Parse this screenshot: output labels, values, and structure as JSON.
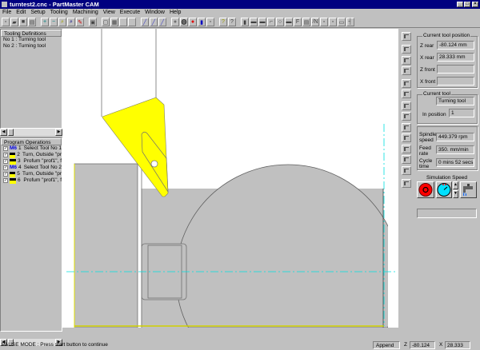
{
  "window": {
    "title": "turntest2.cnc - PartMaster CAM",
    "controls": [
      "_",
      "□",
      "×"
    ]
  },
  "menu": [
    "File",
    "Edit",
    "Setup",
    "Tooling",
    "Machining",
    "View",
    "Execute",
    "Window",
    "Help"
  ],
  "toolbar": {
    "buttons": [
      {
        "icon": "new-file-icon",
        "glyph": "▫"
      },
      {
        "icon": "open-folder-icon",
        "glyph": "▰"
      },
      {
        "icon": "save-icon",
        "glyph": "■"
      },
      {
        "icon": "print-icon",
        "glyph": "▤"
      },
      {
        "sep": true
      },
      {
        "icon": "zoom-in-icon",
        "glyph": "+"
      },
      {
        "icon": "zoom-out-icon",
        "glyph": "−"
      },
      {
        "icon": "zoom-window-icon",
        "glyph": "⌕"
      },
      {
        "icon": "zoom-all-icon",
        "glyph": "⌕"
      },
      {
        "icon": "pencil-icon",
        "glyph": "✎"
      },
      {
        "sep": true
      },
      {
        "icon": "display-icon",
        "glyph": "▣"
      },
      {
        "sep": true
      },
      {
        "icon": "view-icon",
        "glyph": "▢"
      },
      {
        "icon": "layout-icon",
        "glyph": "▦"
      },
      {
        "icon": "blank-icon",
        "glyph": ""
      },
      {
        "icon": "blank-icon",
        "glyph": ""
      },
      {
        "sep": true
      },
      {
        "icon": "tool-path-icon",
        "glyph": "╱"
      },
      {
        "icon": "tool-path-active-icon",
        "glyph": "╱"
      },
      {
        "icon": "line-icon",
        "glyph": "╱"
      },
      {
        "sep": true
      },
      {
        "icon": "stop-gray-icon",
        "glyph": "●"
      },
      {
        "icon": "pause-icon",
        "glyph": "⓿"
      },
      {
        "icon": "stop-red-icon",
        "glyph": "●"
      },
      {
        "icon": "step-icon",
        "glyph": "▮"
      },
      {
        "icon": "single-step-icon",
        "glyph": "▫"
      },
      {
        "sep": true
      },
      {
        "icon": "help-icon",
        "glyph": "?"
      },
      {
        "icon": "context-help-icon",
        "glyph": "?"
      },
      {
        "sep": true
      },
      {
        "icon": "op-1-icon",
        "glyph": "▮"
      },
      {
        "icon": "op-2-icon",
        "glyph": "▬"
      },
      {
        "icon": "op-3-icon",
        "glyph": "▬"
      },
      {
        "icon": "op-4-icon",
        "glyph": "⌐"
      },
      {
        "icon": "op-5-icon",
        "glyph": "○"
      },
      {
        "icon": "op-6-icon",
        "glyph": "▬"
      },
      {
        "icon": "op-7-icon",
        "glyph": "F"
      },
      {
        "icon": "op-8-icon",
        "glyph": "▤"
      },
      {
        "icon": "op-9-icon",
        "glyph": "/N"
      },
      {
        "icon": "op-10-icon",
        "glyph": "▫"
      },
      {
        "icon": "op-11-icon",
        "glyph": "▫"
      },
      {
        "icon": "op-12-icon",
        "glyph": "▭"
      },
      {
        "icon": "op-13-icon",
        "glyph": "┤"
      }
    ]
  },
  "tooling": {
    "header": "Tooling Definitions",
    "items": [
      "No 1 : Turning tool",
      "No 2 : Turning tool"
    ]
  },
  "operations": {
    "header": "Program Operations",
    "items": [
      {
        "code": "M6",
        "num": "1",
        "text": "Select Tool No 1",
        "checked": true
      },
      {
        "code": "",
        "num": "2",
        "text": "Turn, Outside \"pr",
        "checked": true
      },
      {
        "code": "",
        "num": "3",
        "text": "Profum \"prof1\", f",
        "checked": true
      },
      {
        "code": "M6",
        "num": "4",
        "text": "Select Tool No 2",
        "checked": true
      },
      {
        "code": "",
        "num": "5",
        "text": "Turn, Outside \"pr",
        "checked": true
      },
      {
        "code": "",
        "num": "6",
        "text": "Profum \"prof1\", f",
        "checked": true
      }
    ]
  },
  "position": {
    "title": "Current tool position",
    "z_rear_label": "Z rear",
    "z_rear": "-80.124 mm",
    "x_rear_label": "X rear",
    "x_rear": "28.333 mm",
    "z_front_label": "Z front",
    "z_front": "",
    "x_front_label": "X front",
    "x_front": ""
  },
  "current_tool": {
    "title": "Current tool",
    "name": "Turning tool",
    "in_position_label": "In position",
    "in_position": "1"
  },
  "machining": {
    "spindle_label": "Spindle speed",
    "spindle": "449.379 rpm",
    "feed_label": "Feed rate",
    "feed": "350. mm/min",
    "cycle_label": "Cycle time",
    "cycle": "0 mins 52 secs"
  },
  "simulation": {
    "title": "Simulation Speed",
    "progress": ""
  },
  "status": {
    "message": "PAUSE MODE : Press start button to continue",
    "mode": "Append",
    "z_label": "Z",
    "z": "-80.124",
    "x_label": "X",
    "x": "28.333"
  },
  "colors": {
    "title_bar": "#000080",
    "insert": "#ffff00",
    "stock": "#c0c0c0",
    "centerline": "#00e0e0"
  }
}
